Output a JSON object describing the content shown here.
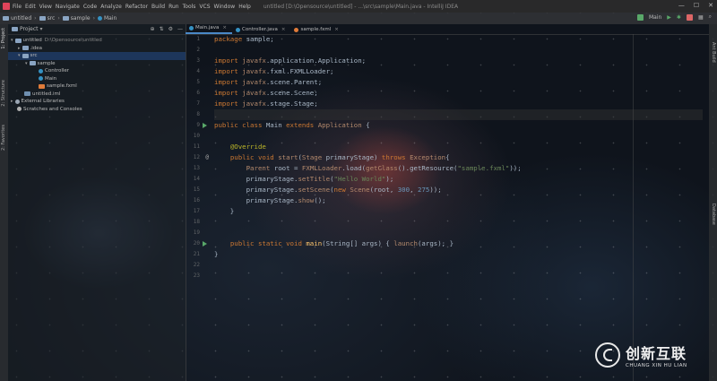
{
  "titlebar": {
    "menu": [
      "File",
      "Edit",
      "View",
      "Navigate",
      "Code",
      "Analyze",
      "Refactor",
      "Build",
      "Run",
      "Tools",
      "VCS",
      "Window",
      "Help"
    ],
    "title": "untitled [D:\\Opensource\\untitled] - ...\\src\\sample\\Main.java - IntelliJ IDEA"
  },
  "breadcrumb": [
    "untitled",
    "src",
    "sample",
    "Main"
  ],
  "run_config": "Main",
  "project_panel": {
    "title": "Project",
    "tree": [
      {
        "label": "untitled",
        "path": "D:\\Opensource\\untitled",
        "indent": 0,
        "icon": "folder",
        "open": true
      },
      {
        "label": ".idea",
        "indent": 1,
        "icon": "folder",
        "open": false
      },
      {
        "label": "src",
        "indent": 1,
        "icon": "folder",
        "open": true,
        "selected": true
      },
      {
        "label": "sample",
        "indent": 2,
        "icon": "package",
        "open": true
      },
      {
        "label": "Controller",
        "indent": 3,
        "icon": "class"
      },
      {
        "label": "Main",
        "indent": 3,
        "icon": "class"
      },
      {
        "label": "sample.fxml",
        "indent": 3,
        "icon": "fxml"
      },
      {
        "label": "untitled.iml",
        "indent": 1,
        "icon": "iml"
      },
      {
        "label": "External Libraries",
        "indent": 0,
        "icon": "lib",
        "open": false
      },
      {
        "label": "Scratches and Consoles",
        "indent": 0,
        "icon": "scratch"
      }
    ]
  },
  "side_tabs": {
    "left": [
      "1: Project",
      "2: Structure",
      "2: Favorites"
    ],
    "right": [
      "Ant Build",
      "Database"
    ]
  },
  "tabs": [
    {
      "label": "Main.java",
      "active": true
    },
    {
      "label": "Controller.java",
      "active": false
    },
    {
      "label": "sample.fxml",
      "active": false
    }
  ],
  "gutter": {
    "line_numbers": [
      "1",
      "2",
      "3",
      "4",
      "5",
      "6",
      "7",
      "8",
      "9",
      "10",
      "11",
      "12",
      "13",
      "14",
      "15",
      "16",
      "17",
      "18",
      "19",
      "20",
      "21",
      "22",
      "23"
    ]
  },
  "code": [
    [
      [
        "kw",
        "package "
      ],
      [
        "pl",
        "sample;"
      ]
    ],
    [],
    [
      [
        "kw",
        "import "
      ],
      [
        "im",
        "javafx"
      ],
      [
        "pl",
        ".application.Application;"
      ]
    ],
    [
      [
        "kw",
        "import "
      ],
      [
        "im",
        "javafx"
      ],
      [
        "pl",
        ".fxml.FXMLLoader;"
      ]
    ],
    [
      [
        "kw",
        "import "
      ],
      [
        "im",
        "javafx"
      ],
      [
        "pl",
        ".scene.Parent;"
      ]
    ],
    [
      [
        "kw",
        "import "
      ],
      [
        "im",
        "javafx"
      ],
      [
        "pl",
        ".scene.Scene;"
      ]
    ],
    [
      [
        "kw",
        "import "
      ],
      [
        "im",
        "javafx"
      ],
      [
        "pl",
        ".stage.Stage;"
      ]
    ],
    [],
    [
      [
        "kw",
        "public class "
      ],
      [
        "pl",
        "Main "
      ],
      [
        "kw",
        "extends "
      ],
      [
        "im",
        "Application "
      ],
      [
        "pl",
        "{"
      ]
    ],
    [],
    [
      [
        "pl",
        "    "
      ],
      [
        "ann",
        "@Override"
      ]
    ],
    [
      [
        "pl",
        "    "
      ],
      [
        "kw",
        "public void "
      ],
      [
        "im",
        "start"
      ],
      [
        "pl",
        "("
      ],
      [
        "im",
        "Stage "
      ],
      [
        "pl",
        "primaryStage) "
      ],
      [
        "kw",
        "throws "
      ],
      [
        "im",
        "Exception"
      ],
      [
        "pl",
        "{"
      ]
    ],
    [
      [
        "pl",
        "        "
      ],
      [
        "im",
        "Parent "
      ],
      [
        "pl",
        "root = "
      ],
      [
        "im",
        "FXMLLoader"
      ],
      [
        "pl",
        ".load("
      ],
      [
        "im",
        "getClass"
      ],
      [
        "pl",
        "().getResource("
      ],
      [
        "str",
        "\"sample.fxml\""
      ],
      [
        "pl",
        "));"
      ]
    ],
    [
      [
        "pl",
        "        primaryStage."
      ],
      [
        "im",
        "setTitle"
      ],
      [
        "pl",
        "("
      ],
      [
        "str",
        "\"Hello World\""
      ],
      [
        "pl",
        ");"
      ]
    ],
    [
      [
        "pl",
        "        primaryStage."
      ],
      [
        "im",
        "setScene"
      ],
      [
        "pl",
        "("
      ],
      [
        "kw",
        "new "
      ],
      [
        "im",
        "Scene"
      ],
      [
        "pl",
        "(root, "
      ],
      [
        "num",
        "300"
      ],
      [
        "pl",
        ", "
      ],
      [
        "num",
        "275"
      ],
      [
        "pl",
        "));"
      ]
    ],
    [
      [
        "pl",
        "        primaryStage."
      ],
      [
        "im",
        "show"
      ],
      [
        "pl",
        "();"
      ]
    ],
    [
      [
        "pl",
        "    }"
      ]
    ],
    [],
    [],
    [
      [
        "pl",
        "    "
      ],
      [
        "kw",
        "public static void "
      ],
      [
        "fn",
        "main"
      ],
      [
        "pl",
        "(String[] args) { "
      ],
      [
        "im",
        "launch"
      ],
      [
        "pl",
        "(args); }"
      ]
    ],
    [
      [
        "pl",
        "}"
      ]
    ],
    [],
    []
  ],
  "watermark": {
    "cn": "创新互联",
    "en": "CHUANG XIN HU LIAN"
  },
  "colors": {
    "keyword": "#cc7832",
    "string": "#6a8759",
    "annotation": "#bbb529",
    "number": "#6897bb",
    "accent": "#4a88c7"
  }
}
